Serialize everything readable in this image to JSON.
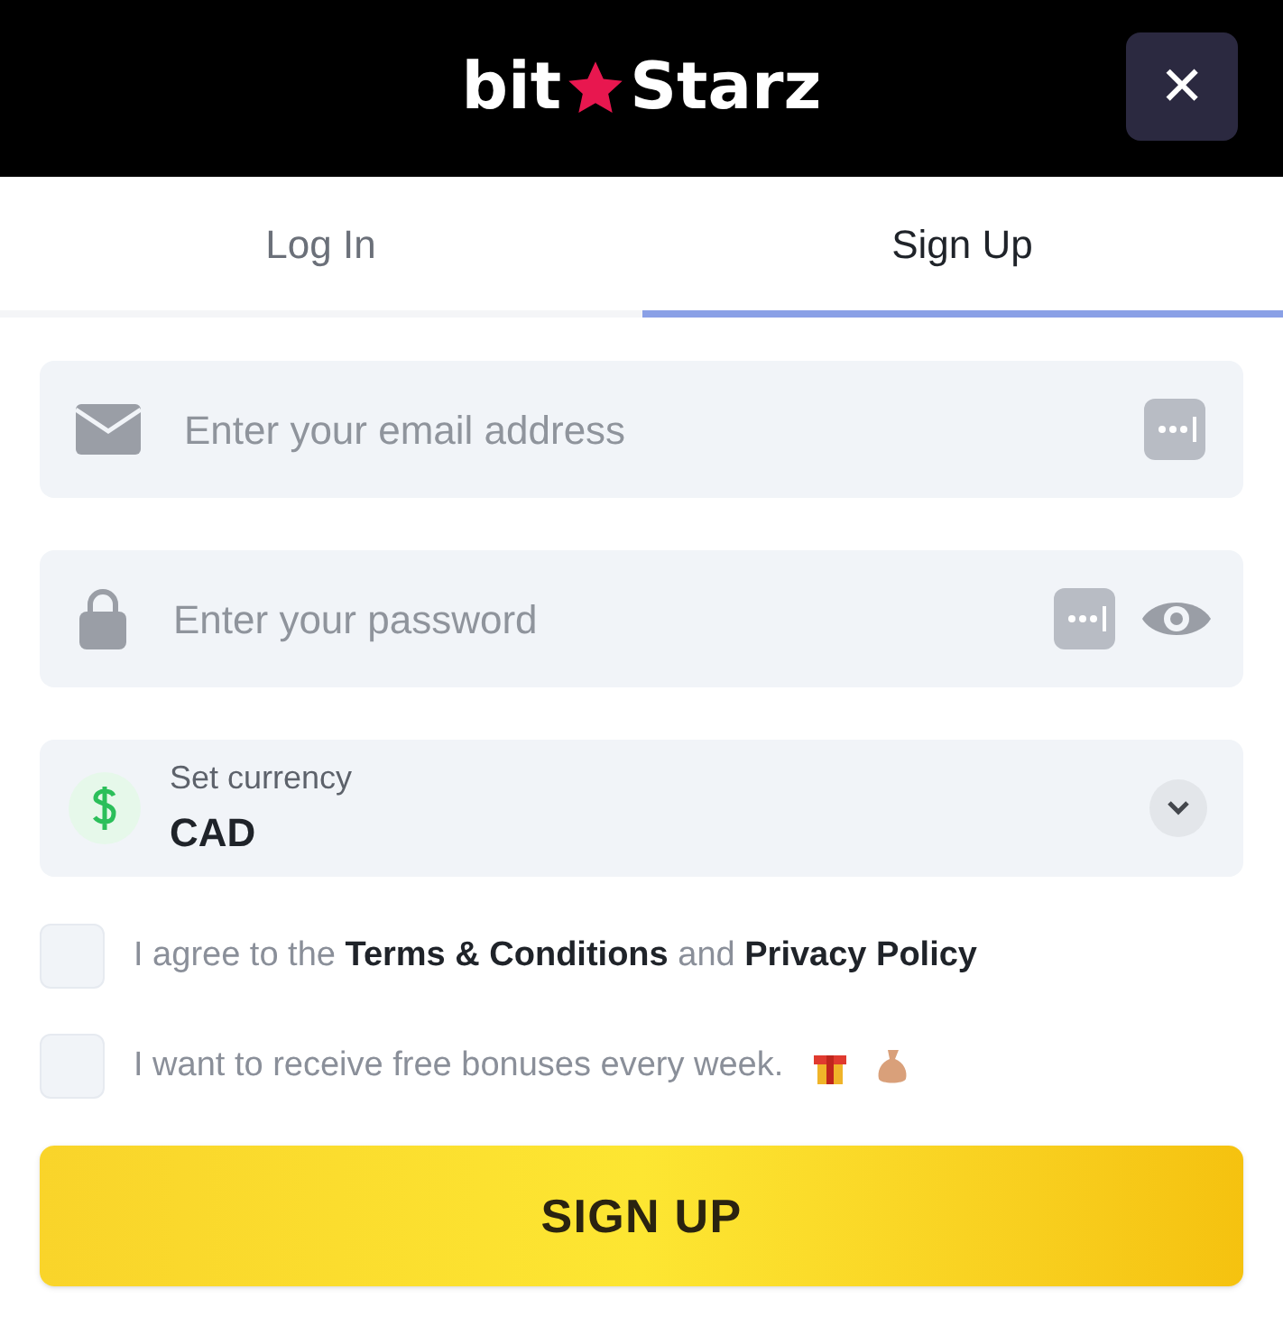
{
  "logo": {
    "left": "bit",
    "right": "Starz"
  },
  "close_label": "✕",
  "tabs": [
    {
      "label": "Log In",
      "selected": false
    },
    {
      "label": "Sign Up",
      "selected": true
    }
  ],
  "email": {
    "placeholder": "Enter your email address"
  },
  "password": {
    "placeholder": "Enter your password"
  },
  "currency": {
    "label": "Set currency",
    "value": "CAD"
  },
  "consents": [
    {
      "kind": "terms",
      "checked": false,
      "prefix": "I agree to the",
      "link_1": "Terms & Conditions",
      "middle": "and",
      "link_2": "Privacy Policy"
    },
    {
      "kind": "bonus",
      "checked": false,
      "text": "I want to receive free bonuses every week."
    }
  ],
  "submit": "SIGN UP"
}
